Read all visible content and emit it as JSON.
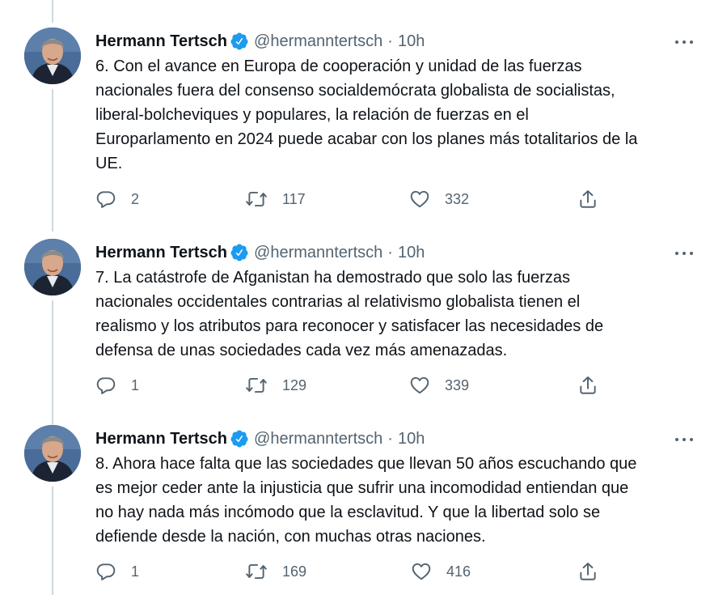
{
  "tweets": [
    {
      "name": "Hermann Tertsch",
      "handle": "@hermanntertsch",
      "separator": "·",
      "time": "10h",
      "text": "6. Con el avance en Europa de cooperación y unidad de las fuerzas\nnacionales fuera del consenso socialdemócrata globalista de socialistas,\nliberal-bolcheviques y populares, la relación de fuerzas en el\nEuroparlamento en 2024 puede acabar con los planes más totalitarios de la\nUE.",
      "replies": "2",
      "retweets": "117",
      "likes": "332"
    },
    {
      "name": "Hermann Tertsch",
      "handle": "@hermanntertsch",
      "separator": "·",
      "time": "10h",
      "text": "7. La catástrofe de Afganistan ha demostrado que solo las fuerzas\nnacionales occidentales contrarias al relativismo globalista tienen el\nrealismo y los atributos para reconocer y satisfacer las necesidades de\ndefensa de unas sociedades cada vez más amenazadas.",
      "replies": "1",
      "retweets": "129",
      "likes": "339"
    },
    {
      "name": "Hermann Tertsch",
      "handle": "@hermanntertsch",
      "separator": "·",
      "time": "10h",
      "text": "8. Ahora hace falta que las sociedades que llevan 50 años escuchando que\nes mejor ceder ante la injusticia que sufrir una incomodidad entiendan que\nno hay nada más incómodo que la esclavitud. Y que la libertad solo se\ndefiende desde la nación, con muchas otras naciones.",
      "replies": "1",
      "retweets": "169",
      "likes": "416"
    }
  ],
  "icons": {
    "verified": "verified-badge-icon",
    "more": "more-options-icon",
    "reply": "reply-icon",
    "retweet": "retweet-icon",
    "like": "heart-icon",
    "share": "share-icon"
  },
  "colors": {
    "verified": "#1d9bf0",
    "secondary_text": "#536471",
    "thread_line": "#cfd9de"
  }
}
